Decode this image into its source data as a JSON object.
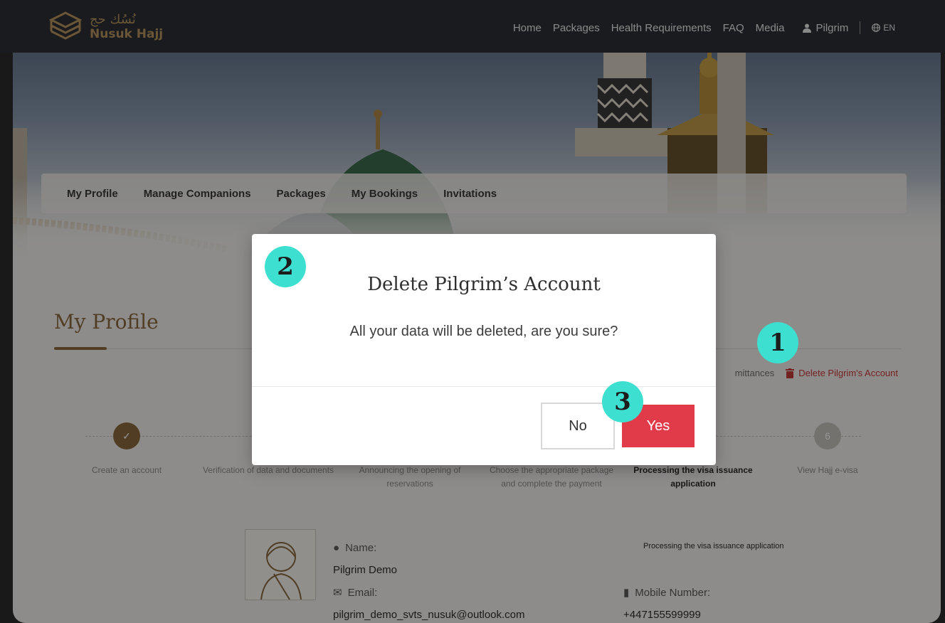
{
  "brand": {
    "name_ar": "نُسُك حج",
    "name_en": "Nusuk Hajj",
    "gold": "#b8945f"
  },
  "nav": {
    "items": [
      "Home",
      "Packages",
      "Health Requirements",
      "FAQ",
      "Media"
    ],
    "user": "Pilgrim",
    "lang": "EN"
  },
  "tabs": [
    "My Profile",
    "Manage Companions",
    "Packages",
    "My Bookings",
    "Invitations"
  ],
  "profile": {
    "title": "My Profile",
    "actions": {
      "remittances": "mittances",
      "delete": "Delete Pilgrim's Account"
    },
    "steps": [
      {
        "num": "✓",
        "label": "Create an account",
        "state": "done"
      },
      {
        "num": "",
        "label": "Verification of data and documents",
        "state": "done"
      },
      {
        "num": "",
        "label": "Announcing the opening of reservations",
        "state": "done"
      },
      {
        "num": "",
        "label": "Choose the appropriate package and complete the payment",
        "state": "done"
      },
      {
        "num": "",
        "label": "Processing the visa issuance application",
        "state": "current"
      },
      {
        "num": "6",
        "label": "View Hajj e-visa",
        "state": "pending"
      }
    ],
    "name_label": "Name:",
    "name_value": "Pilgrim Demo",
    "email_label": "Email:",
    "email_value": "pilgrim_demo_svts_nusuk@outlook.com",
    "mobile_label": "Mobile Number:",
    "mobile_value": "+447155599999",
    "status_text": "Processing the visa issuance application"
  },
  "modal": {
    "title": "Delete Pilgrim’s Account",
    "message": "All your data will be deleted, are you sure?",
    "no_label": "No",
    "yes_label": "Yes"
  },
  "badges": {
    "one": "1",
    "two": "2",
    "three": "3"
  },
  "colors": {
    "danger": "#e13b4a",
    "badge": "#3ddfd0",
    "step_done": "#8a6a3e"
  }
}
